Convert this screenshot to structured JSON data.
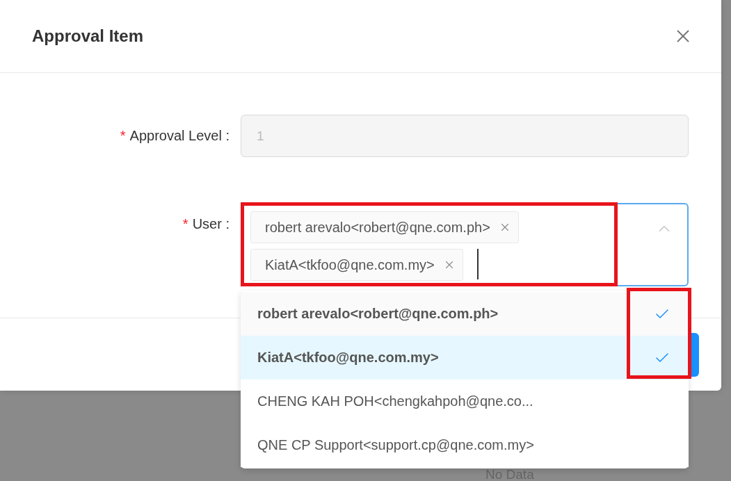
{
  "modal": {
    "title": "Approval Item"
  },
  "form": {
    "fields": [
      {
        "kind": "text",
        "label": "Approval Level :",
        "required": true,
        "required_mark": "*",
        "disabled": true,
        "value": "1"
      },
      {
        "kind": "tags",
        "label": "User :",
        "required": true,
        "required_mark": "*",
        "open": true,
        "tags": [
          "robert arevalo<robert@qne.com.ph>",
          "KiatA<tkfoo@qne.com.my>"
        ]
      }
    ]
  },
  "dropdown": {
    "options": [
      {
        "label": "robert arevalo<robert@qne.com.ph>",
        "selected": true,
        "highlighted": false
      },
      {
        "label": "KiatA<tkfoo@qne.com.my>",
        "selected": true,
        "highlighted": true
      },
      {
        "label": "CHENG KAH POH<chengkahpoh@qne.co...",
        "selected": false,
        "highlighted": false
      },
      {
        "label": "QNE CP Support<support.cp@qne.com.my>",
        "selected": false,
        "highlighted": false
      }
    ]
  },
  "background": {
    "empty_text": "No Data"
  }
}
